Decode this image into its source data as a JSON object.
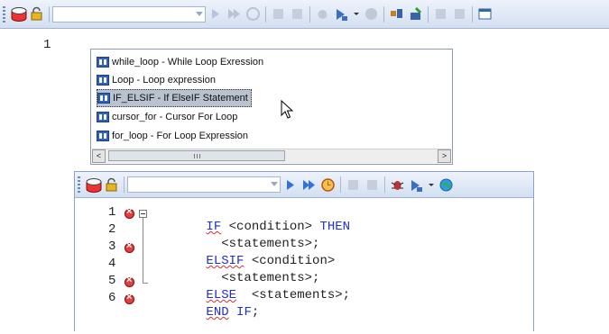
{
  "top_window": {
    "toolbar": {
      "database_icon": "database-icon",
      "lock_icon": "lock-icon",
      "combo_value": "",
      "icons": [
        "run-icon",
        "run-all-icon",
        "clock-icon",
        "commit-icon",
        "rollback-icon",
        "debug-icon",
        "step-icon",
        "chevron-down-icon",
        "stop-icon",
        "explain-icon",
        "profile-icon",
        "format-icon",
        "save-icon",
        "window-icon"
      ]
    },
    "editor": {
      "line_numbers": [
        "1"
      ]
    },
    "autocomplete": {
      "items": [
        {
          "label": "while_loop - While Loop Exression",
          "selected": false
        },
        {
          "label": "Loop - Loop expression",
          "selected": false
        },
        {
          "label": "IF_ELSIF - If ElseIF Statement",
          "selected": true
        },
        {
          "label": "cursor_for - Cursor For Loop",
          "selected": false
        },
        {
          "label": "for_loop - For Loop Expression",
          "selected": false
        }
      ],
      "scroll_left": "<",
      "scroll_right": ">"
    }
  },
  "bottom_window": {
    "toolbar": {
      "combo_value": ""
    },
    "editor": {
      "lines": [
        {
          "num": "1",
          "error": true,
          "parts": [
            {
              "t": "IF",
              "c": "kw-u"
            },
            {
              "t": " <condition> ",
              "c": ""
            },
            {
              "t": "THEN",
              "c": "kw"
            }
          ]
        },
        {
          "num": "2",
          "error": false,
          "parts": [
            {
              "t": "  <statements>;",
              "c": ""
            }
          ]
        },
        {
          "num": "3",
          "error": true,
          "parts": [
            {
              "t": "ELSIF",
              "c": "kw-u"
            },
            {
              "t": " <condition>",
              "c": ""
            }
          ]
        },
        {
          "num": "4",
          "error": false,
          "parts": [
            {
              "t": "  <statements>;",
              "c": ""
            }
          ]
        },
        {
          "num": "5",
          "error": true,
          "parts": [
            {
              "t": "ELSE",
              "c": "kw-u"
            },
            {
              "t": "  <statements>;",
              "c": ""
            }
          ]
        },
        {
          "num": "6",
          "error": true,
          "parts": [
            {
              "t": "END",
              "c": "kw-u"
            },
            {
              "t": " ",
              "c": ""
            },
            {
              "t": "IF",
              "c": "kw"
            },
            {
              "t": ";",
              "c": ""
            }
          ]
        }
      ]
    }
  },
  "colors": {
    "keyword": "#1e31c8",
    "error": "#e04040",
    "selection": "#b9c2cf"
  }
}
